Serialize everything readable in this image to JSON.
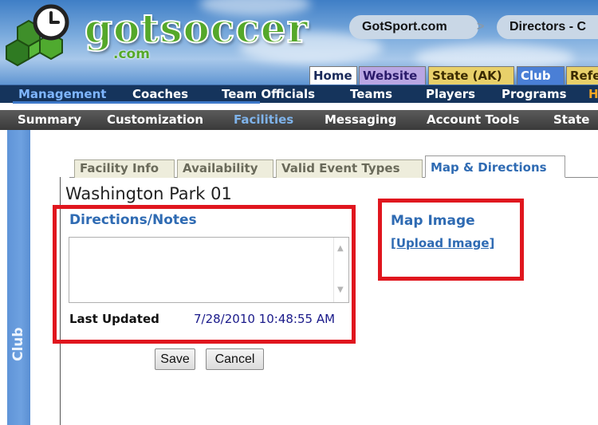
{
  "header": {
    "logo_text": "gotsoccer",
    "logo_sub": ".com",
    "top_links": [
      "GotSport.com",
      "Directors - C"
    ],
    "chevron": ">",
    "tabs": [
      "Home",
      "Website",
      "State (AK)",
      "Club",
      "Refe"
    ]
  },
  "nav_primary": [
    "Management",
    "Coaches",
    "Team Officials",
    "Teams",
    "Players",
    "Programs",
    "H"
  ],
  "nav_secondary": [
    "Summary",
    "Customization",
    "Facilities",
    "Messaging",
    "Account Tools",
    "State"
  ],
  "sidebar": {
    "label": "Club"
  },
  "subtabs": [
    "Facility Info",
    "Availability",
    "Valid Event Types",
    "Map & Directions"
  ],
  "facility": {
    "name": "Washington Park 01",
    "directions_label": "Directions/Notes",
    "directions_value": "",
    "last_updated_label": "Last Updated",
    "last_updated_value": "7/28/2010 10:48:55 AM"
  },
  "map": {
    "label": "Map Image",
    "upload_link": "[Upload Image]"
  },
  "buttons": {
    "save": "Save",
    "cancel": "Cancel"
  },
  "colors": {
    "accent_blue": "#2f6bb3",
    "highlight_red": "#e0161e",
    "nav_dark": "#15345c",
    "logo_green": "#55a82a"
  }
}
